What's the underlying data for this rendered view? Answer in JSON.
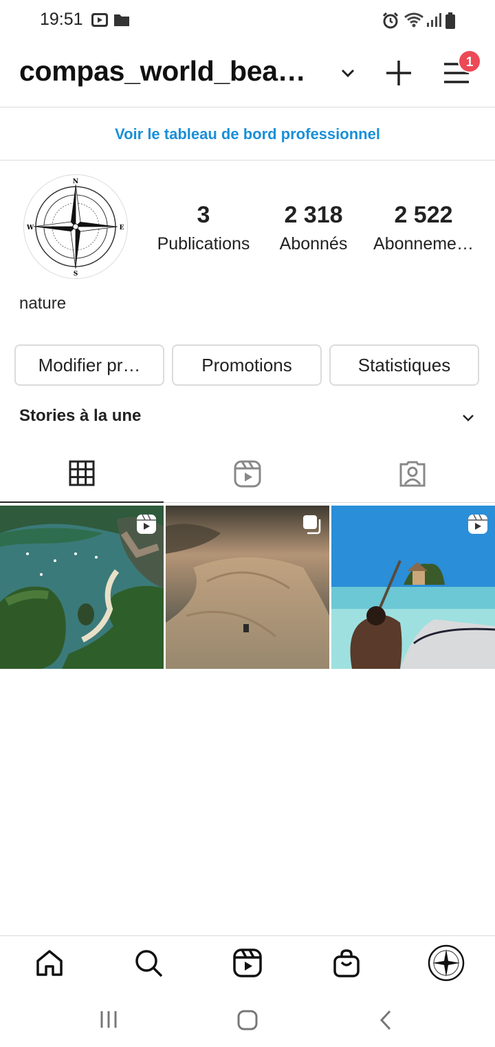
{
  "status_bar": {
    "time": "19:51",
    "left_icons": [
      "youtube-icon",
      "folder-icon"
    ],
    "right_icons": [
      "alarm-icon",
      "wifi-icon",
      "signal-icon",
      "battery-icon"
    ]
  },
  "header": {
    "username": "compas_world_bea…",
    "notification_count": "1",
    "icons": [
      "chevron-down-icon",
      "plus-icon",
      "menu-icon"
    ]
  },
  "professional_dashboard_link": "Voir le tableau de bord professionnel",
  "profile": {
    "stats": [
      {
        "value": "3",
        "label": "Publications"
      },
      {
        "value": "2 318",
        "label": "Abonnés"
      },
      {
        "value": "2 522",
        "label": "Abonneme…"
      }
    ],
    "bio": "nature",
    "buttons": [
      "Modifier pr…",
      "Promotions",
      "Statistiques"
    ],
    "highlights_label": "Stories à la une"
  },
  "compass_letters": {
    "n": "N",
    "s": "S",
    "e": "E",
    "w": "W"
  },
  "tabs": [
    "grid-icon",
    "reels-icon",
    "tagged-icon"
  ],
  "posts": [
    {
      "type": "reel",
      "icon": "reel-icon",
      "scene": "tropical-bay"
    },
    {
      "type": "carousel",
      "icon": "carousel-icon",
      "scene": "desert-dunes"
    },
    {
      "type": "reel",
      "icon": "reel-icon",
      "scene": "sea-restaurant"
    }
  ],
  "bottom_nav": [
    "home-icon",
    "search-icon",
    "reels-icon",
    "shop-icon",
    "profile-avatar"
  ],
  "system_nav": [
    "recents-icon",
    "home-button-icon",
    "back-icon"
  ]
}
